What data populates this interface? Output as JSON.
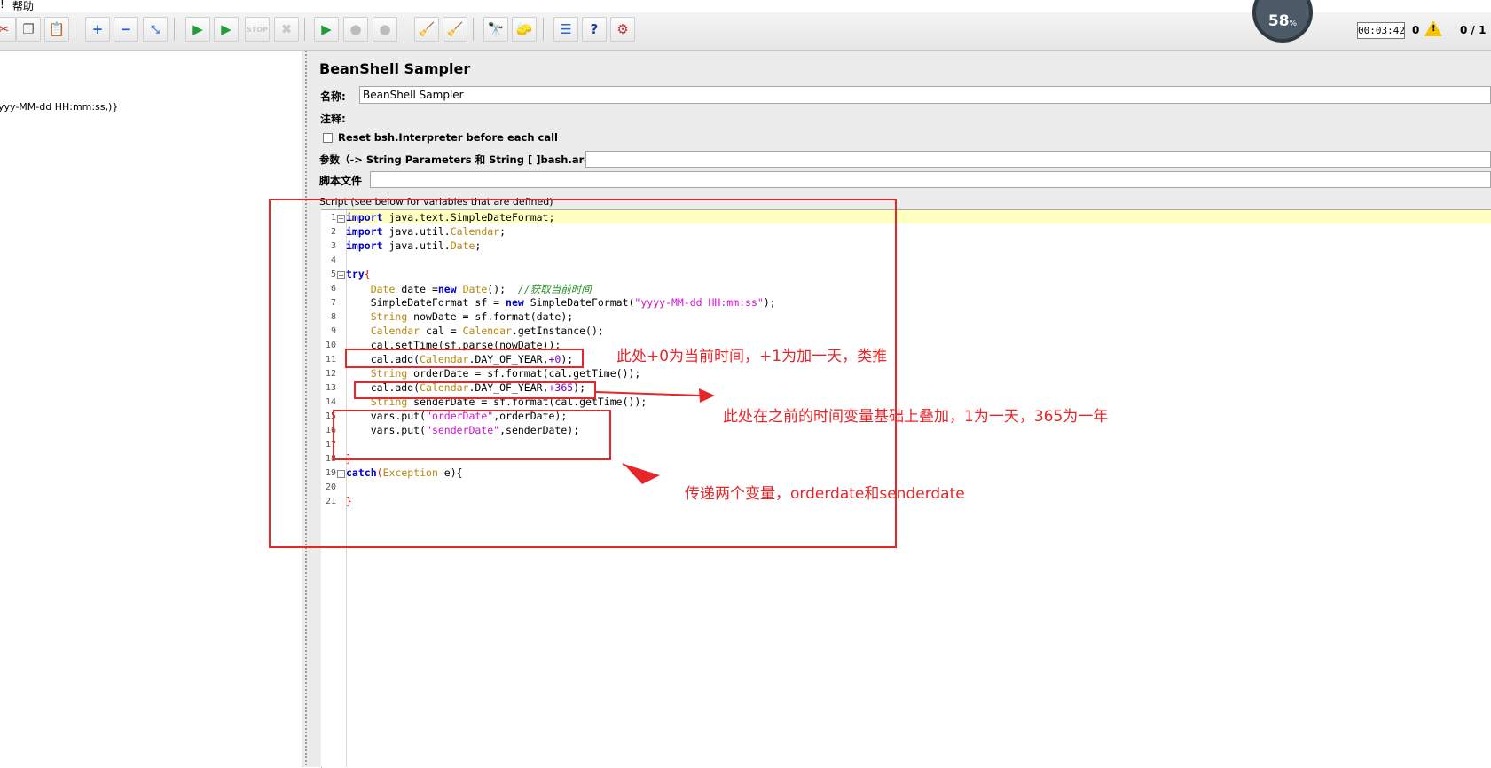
{
  "menubar": {
    "left_fragment": "!",
    "help": "帮助"
  },
  "toolbar": {
    "timer": "00:03:42",
    "warnings": "0",
    "threads": "0 / 1",
    "gauge": "58",
    "gauge_unit": "%"
  },
  "left_panel": {
    "snippet": "yyy-MM-dd HH:mm:ss,)}"
  },
  "panel": {
    "title": "BeanShell Sampler",
    "name_label": "名称:",
    "name_value": "BeanShell Sampler",
    "comment_label": "注释:",
    "reset_label": "Reset bsh.Interpreter before each call",
    "params_label": "参数（-> String Parameters 和 String [ ]bash.args）",
    "file_label": "脚本文件",
    "script_label": "Script (see below for variables that are defined)"
  },
  "line_numbers": [
    "1",
    "2",
    "3",
    "4",
    "5",
    "6",
    "7",
    "8",
    "9",
    "10",
    "11",
    "12",
    "13",
    "14",
    "15",
    "16",
    "17",
    "18",
    "19",
    "20",
    "21"
  ],
  "code": {
    "l1": [
      "import",
      " java.text.SimpleDateFormat;"
    ],
    "l2": [
      "import",
      " java.util.",
      "Calendar",
      ";"
    ],
    "l3": [
      "import",
      " java.util.",
      "Date",
      ";"
    ],
    "l5": [
      "try",
      "{"
    ],
    "l6": [
      "    ",
      "Date",
      " date =",
      "new",
      " ",
      "Date",
      "();  ",
      "//获取当前时间"
    ],
    "l7": [
      "    SimpleDateFormat sf = ",
      "new",
      " SimpleDateFormat(",
      "\"yyyy-MM-dd HH:mm:ss\"",
      ");"
    ],
    "l8": [
      "    ",
      "String",
      " nowDate = sf.format(date);"
    ],
    "l9": [
      "    ",
      "Calendar",
      " cal = ",
      "Calendar",
      ".getInstance();"
    ],
    "l10": [
      "    cal.setTime(sf.parse(nowDate));"
    ],
    "l11": [
      "    cal.add(",
      "Calendar",
      ".DAY_OF_YEAR,",
      "+0",
      ");"
    ],
    "l12": [
      "    ",
      "String",
      " orderDate = sf.format(cal.getTime());"
    ],
    "l13": [
      "    cal.add(",
      "Calendar",
      ".DAY_OF_YEAR,",
      "+365",
      ");"
    ],
    "l14": [
      "    ",
      "String",
      " senderDate = sf.format(cal.getTime());"
    ],
    "l15": [
      "    vars.put(",
      "\"orderDate\"",
      ",orderDate);"
    ],
    "l16": [
      "    vars.put(",
      "\"senderDate\"",
      ",senderDate);"
    ],
    "l18": [
      "}"
    ],
    "l19": [
      "catch",
      "(",
      "Exception",
      " e){"
    ],
    "l21": [
      "}"
    ]
  },
  "annotations": {
    "note1": "此处+0为当前时间，+1为加一天，类推",
    "note2": "此处在之前的时间变量基础上叠加，1为一天，365为一年",
    "note3": "传递两个变量，orderdate和senderdate"
  },
  "colors": {
    "annotation_red": "#e8262a",
    "keyword": "#0000cc",
    "type": "#b8860b",
    "string": "#d10fd1",
    "comment": "#1f8f1f"
  }
}
